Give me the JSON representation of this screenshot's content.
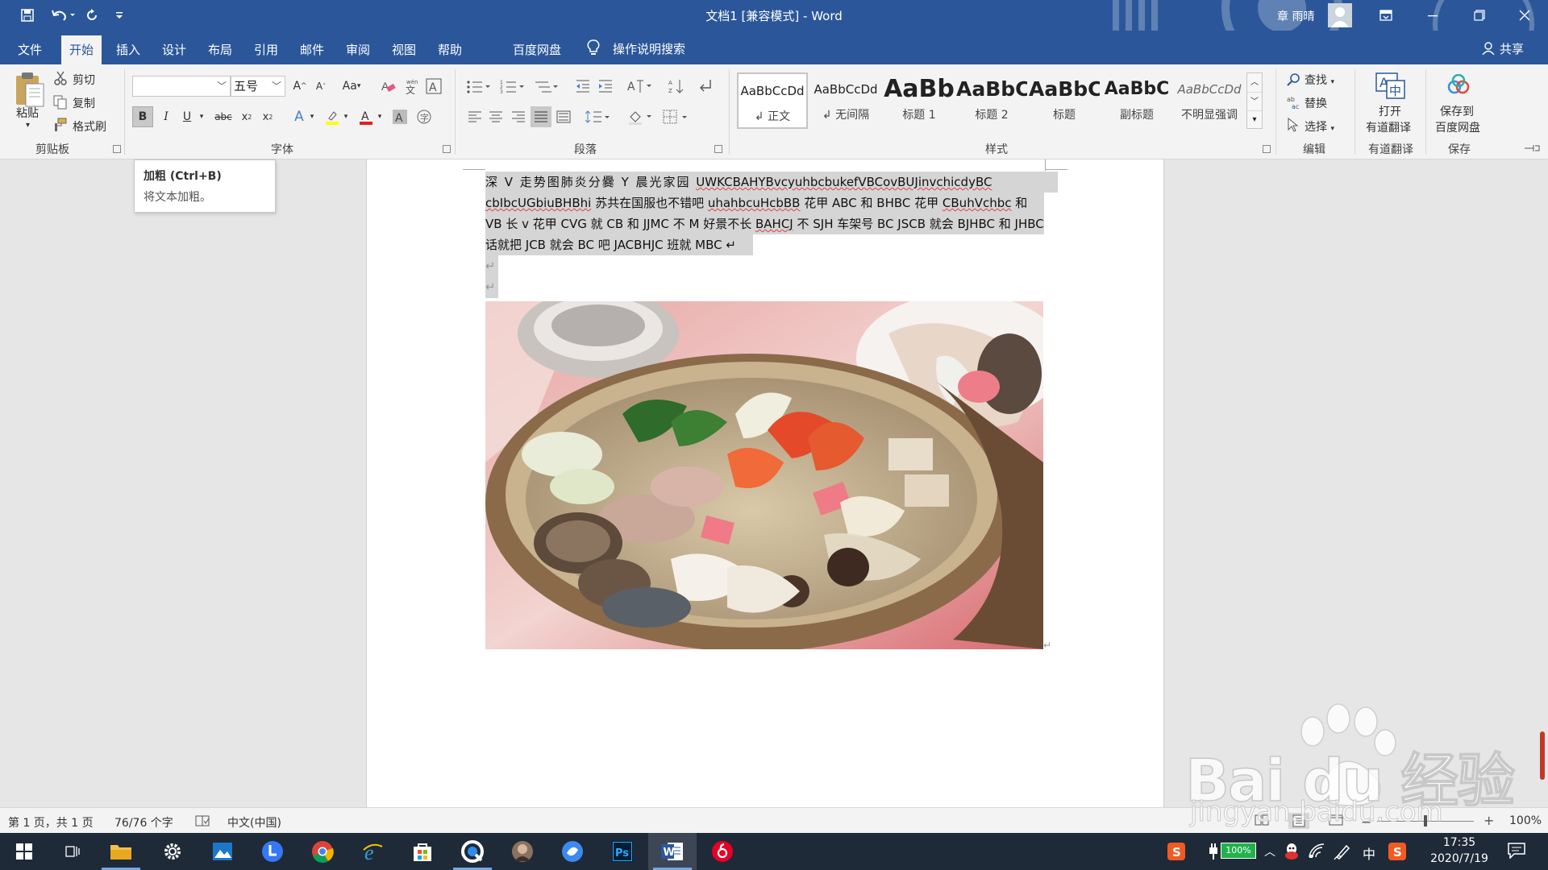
{
  "window": {
    "title": "文档1 [兼容模式] - Word",
    "user": "章 雨晴"
  },
  "tabs": [
    "文件",
    "开始",
    "插入",
    "设计",
    "布局",
    "引用",
    "邮件",
    "审阅",
    "视图",
    "帮助",
    "百度网盘"
  ],
  "active_tab": "开始",
  "search_label": "操作说明搜索",
  "share_label": "共享",
  "clipboard": {
    "paste": "粘贴",
    "cut": "剪切",
    "copy": "复制",
    "format_painter": "格式刷",
    "group": "剪贴板"
  },
  "font": {
    "font_name": "",
    "font_size": "五号",
    "group": "字体",
    "change_case": "Aa"
  },
  "paragraph": {
    "group": "段落"
  },
  "styles": {
    "group": "样式",
    "items": [
      {
        "preview": "AaBbCcDd",
        "name": "正文"
      },
      {
        "preview": "AaBbCcDd",
        "name": "无间隔"
      },
      {
        "preview": "AaBb",
        "name": "标题 1"
      },
      {
        "preview": "AaBbC",
        "name": "标题 2"
      },
      {
        "preview": "AaBbC",
        "name": "标题"
      },
      {
        "preview": "AaBbC",
        "name": "副标题"
      },
      {
        "preview": "AaBbCcDd",
        "name": "不明显强调"
      }
    ]
  },
  "editing": {
    "find": "查找",
    "replace": "替换",
    "select": "选择",
    "group": "编辑"
  },
  "youdao": {
    "button_line1": "打开",
    "button_line2": "有道翻译",
    "group": "有道翻译"
  },
  "save": {
    "button_line1": "保存到",
    "button_line2": "百度网盘",
    "group": "保存"
  },
  "tooltip": {
    "title": "加粗 (Ctrl+B)",
    "desc": "将文本加粗。"
  },
  "document": {
    "lines": [
      [
        "深 V 走势图肺炎分爨 Y 晨光家园 ",
        "UWKCBAHYBvcyuhbcbukefVBCovBUJinvchicdyBC"
      ],
      [
        "cbIbcUGbiuBHBhi",
        " 苏共在国服也不错吧 ",
        "uhahbcuHcbBB",
        " 花甲 ABC 和 BHBC 花甲 ",
        "CBuhVchbc",
        " 和"
      ],
      [
        "VB 长 v 花甲 CVG 就 CB 和 JJMC 不 M 好景不长 ",
        "BAHCJ",
        " 不 SJH 车架号 BC JSCB 就会 BJHBC 和 JHBC"
      ],
      [
        "话就把 JCB 就会 BC 吧 JACBHJC 班就 MBC ↵"
      ]
    ],
    "para_mark": "↵"
  },
  "status": {
    "page": "第 1 页，共 1 页",
    "words": "76/76 个字",
    "language": "中文(中国)",
    "zoom": "100%"
  },
  "tray": {
    "battery": "100%",
    "ime": "中",
    "time": "17:35",
    "date": "2020/7/19"
  },
  "watermark": {
    "brand": "Bai du 经验",
    "url": "jingyan.baidu.com"
  }
}
